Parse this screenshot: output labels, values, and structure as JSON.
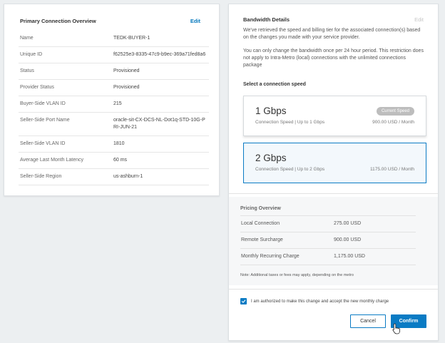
{
  "primary": {
    "title": "Primary Connection Overview",
    "edit_label": "Edit",
    "rows": [
      {
        "label": "Name",
        "value": "TEDK-BUYER-1"
      },
      {
        "label": "Unique ID",
        "value": "f62525e3-8335-47c9-b9ec-369a71fed8a6"
      },
      {
        "label": "Status",
        "value": "Provisioned"
      },
      {
        "label": "Provider Status",
        "value": "Provisioned"
      },
      {
        "label": "Buyer-Side VLAN ID",
        "value": "215"
      },
      {
        "label": "Seller-Side Port Name",
        "value": "oracle-sit-CX-DCS-NL-Dot1q-STD-10G-PRI-JUN-21"
      },
      {
        "label": "Seller-Side VLAN ID",
        "value": "1810"
      },
      {
        "label": "Average Last Month Latency",
        "value": "60 ms"
      },
      {
        "label": "Seller-Side Region",
        "value": "us-ashburn-1"
      }
    ]
  },
  "bandwidth": {
    "title": "Bandwidth Details",
    "edit_label": "Edit",
    "desc1": "We've retrieved the speed and billing tier for the associated connection(s) based on the changes you made with your service provider.",
    "desc2": "You can only change the bandwidth once per 24 hour period. This restriction does not apply to Intra-Metro (local) connections with the unlimited connections package",
    "select_label": "Select a connection speed",
    "options": [
      {
        "title": "1 Gbps",
        "subtitle": "Connection Speed | Up to 1 Gbps",
        "price": "900.00 USD / Month",
        "badge": "Current Speed"
      },
      {
        "title": "2 Gbps",
        "subtitle": "Connection Speed | Up to 2 Gbps",
        "price": "1175.00 USD / Month"
      }
    ]
  },
  "pricing": {
    "title": "Pricing Overview",
    "rows": [
      {
        "label": "Local Connection",
        "value": "275.00 USD"
      },
      {
        "label": "Remote Surcharge",
        "value": "900.00 USD"
      },
      {
        "label": "Monthly Recurring Charge",
        "value": "1,175.00 USD"
      }
    ],
    "note": "Note: Additional taxes or fees may apply, depending on the metro"
  },
  "authorization": {
    "label": "I am authorized to make this change and accept the new monthly charge",
    "checked": true
  },
  "actions": {
    "cancel_label": "Cancel",
    "confirm_label": "Confirm"
  },
  "colors": {
    "accent": "#0a7bc4",
    "link": "#0277bd",
    "badge": "#bdbdbd"
  }
}
